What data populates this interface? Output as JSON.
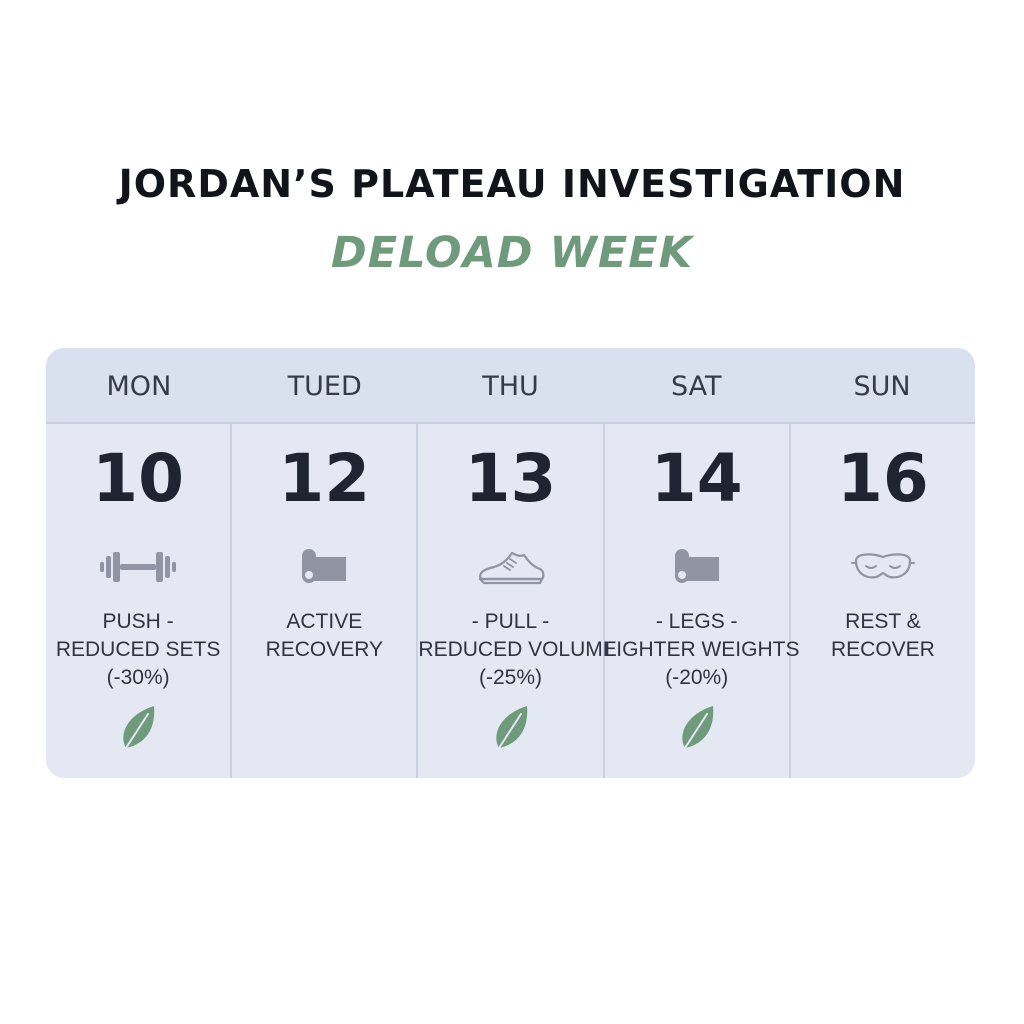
{
  "header": {
    "title": "JORDAN’S PLATEAU INVESTIGATION",
    "subtitle": "DELOAD WEEK"
  },
  "colors": {
    "accent": "#6f9a7c",
    "icon": "#8f95a3",
    "panel": "#e3e8f3"
  },
  "calendar": {
    "days": [
      {
        "name": "MON",
        "date": "10",
        "icon": "dumbbell-icon",
        "lines": [
          "PUSH -",
          "REDUCED SETS",
          "(-30%)"
        ],
        "leaf": true
      },
      {
        "name": "TUED",
        "date": "12",
        "icon": "yoga-mat-icon",
        "lines": [
          "ACTIVE",
          "RECOVERY"
        ],
        "leaf": false
      },
      {
        "name": "THU",
        "date": "13",
        "icon": "sneaker-icon",
        "lines": [
          "- PULL -",
          "REDUCED VOLUME",
          "(-25%)"
        ],
        "leaf": true
      },
      {
        "name": "SAT",
        "date": "14",
        "icon": "yoga-mat-icon",
        "lines": [
          "- LEGS -",
          "LIGHTER WEIGHTS",
          "(-20%)"
        ],
        "leaf": true
      },
      {
        "name": "SUN",
        "date": "16",
        "icon": "sleep-mask-icon",
        "lines": [
          "REST &",
          "RECOVER"
        ],
        "leaf": false
      }
    ]
  }
}
